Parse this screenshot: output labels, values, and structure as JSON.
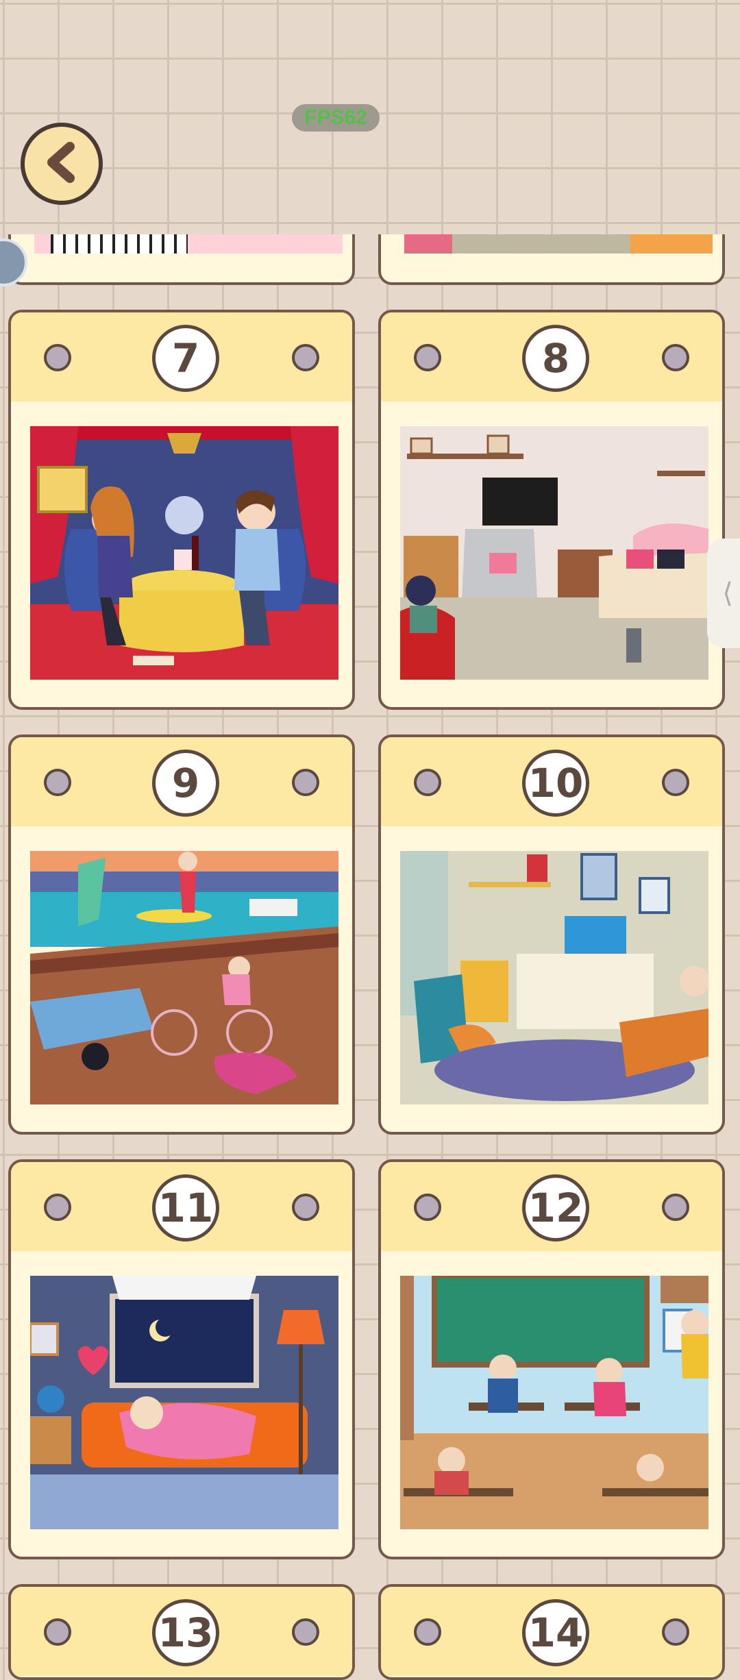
{
  "header": {
    "fps_label": "FPS62",
    "back_icon": "chevron-left-icon"
  },
  "levels": [
    {
      "number": "7",
      "scene": "romantic dinner"
    },
    {
      "number": "8",
      "scene": "living room"
    },
    {
      "number": "9",
      "scene": "beach pier"
    },
    {
      "number": "10",
      "scene": "study room"
    },
    {
      "number": "11",
      "scene": "night sofa"
    },
    {
      "number": "12",
      "scene": "classroom"
    },
    {
      "number": "13",
      "scene": ""
    },
    {
      "number": "14",
      "scene": ""
    }
  ],
  "side_tab": {
    "glyph": "⟨"
  },
  "colors": {
    "card_header": "#fde9a4",
    "card_body": "#fff8dc",
    "card_border": "#74594b",
    "fps_text": "#55bf4a"
  }
}
